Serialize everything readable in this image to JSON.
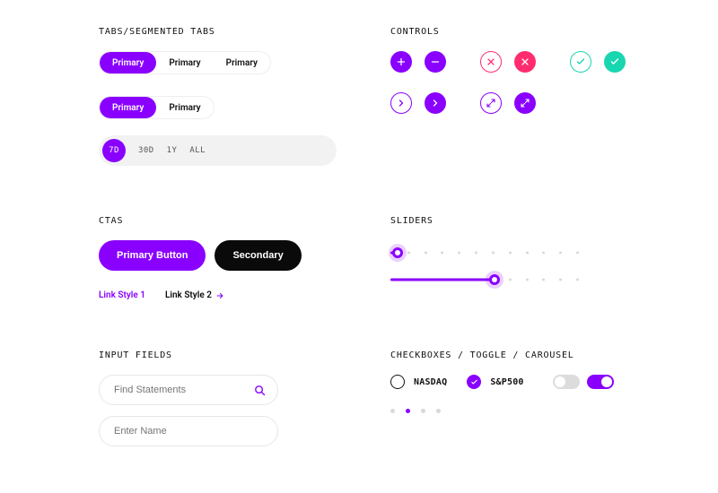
{
  "colors": {
    "accent": "#8a00ff",
    "danger": "#ff2d6f",
    "success": "#18d6b0",
    "dark": "#0a0a0a"
  },
  "sections": {
    "tabs_title": "TABS/SEGMENTED TABS",
    "controls_title": "CONTROLS",
    "ctas_title": "CTAS",
    "sliders_title": "SLIDERS",
    "inputs_title": "INPUT FIELDS",
    "misc_title": "CHECKBOXES / TOGGLE / CAROUSEL"
  },
  "tabs": {
    "group_a": [
      {
        "label": "Primary",
        "active": true
      },
      {
        "label": "Primary",
        "active": false
      },
      {
        "label": "Primary",
        "active": false
      }
    ],
    "group_b": [
      {
        "label": "Primary",
        "active": true
      },
      {
        "label": "Primary",
        "active": false
      }
    ],
    "time": [
      {
        "label": "7D",
        "active": true
      },
      {
        "label": "30D",
        "active": false
      },
      {
        "label": "1Y",
        "active": false
      },
      {
        "label": "ALL",
        "active": false
      }
    ]
  },
  "controls": {
    "row1": [
      {
        "name": "plus-icon",
        "variant": "fill-purple"
      },
      {
        "name": "minus-icon",
        "variant": "fill-purple"
      },
      {
        "name": "close-icon",
        "variant": "outline-pink"
      },
      {
        "name": "close-icon",
        "variant": "fill-pink"
      },
      {
        "name": "check-icon",
        "variant": "outline-teal"
      },
      {
        "name": "check-icon",
        "variant": "fill-teal"
      }
    ],
    "row2": [
      {
        "name": "chevron-right-icon",
        "variant": "outline-purple"
      },
      {
        "name": "chevron-right-icon",
        "variant": "fill-purple"
      },
      {
        "name": "expand-icon",
        "variant": "outline-purple"
      },
      {
        "name": "expand-icon",
        "variant": "fill-purple"
      }
    ]
  },
  "ctas": {
    "primary_label": "Primary Button",
    "secondary_label": "Secondary",
    "link1": "Link Style 1",
    "link2": "Link Style 2"
  },
  "sliders": {
    "ticks": 12,
    "a_percent": 4,
    "b_percent": 55
  },
  "inputs": {
    "search_placeholder": "Find Statements",
    "name_placeholder": "Enter Name"
  },
  "checkboxes": [
    {
      "label": "NASDAQ",
      "checked": false
    },
    {
      "label": "S&P500",
      "checked": true
    }
  ],
  "toggles": [
    {
      "on": false
    },
    {
      "on": true
    }
  ],
  "carousel": {
    "count": 4,
    "active_index": 1
  }
}
